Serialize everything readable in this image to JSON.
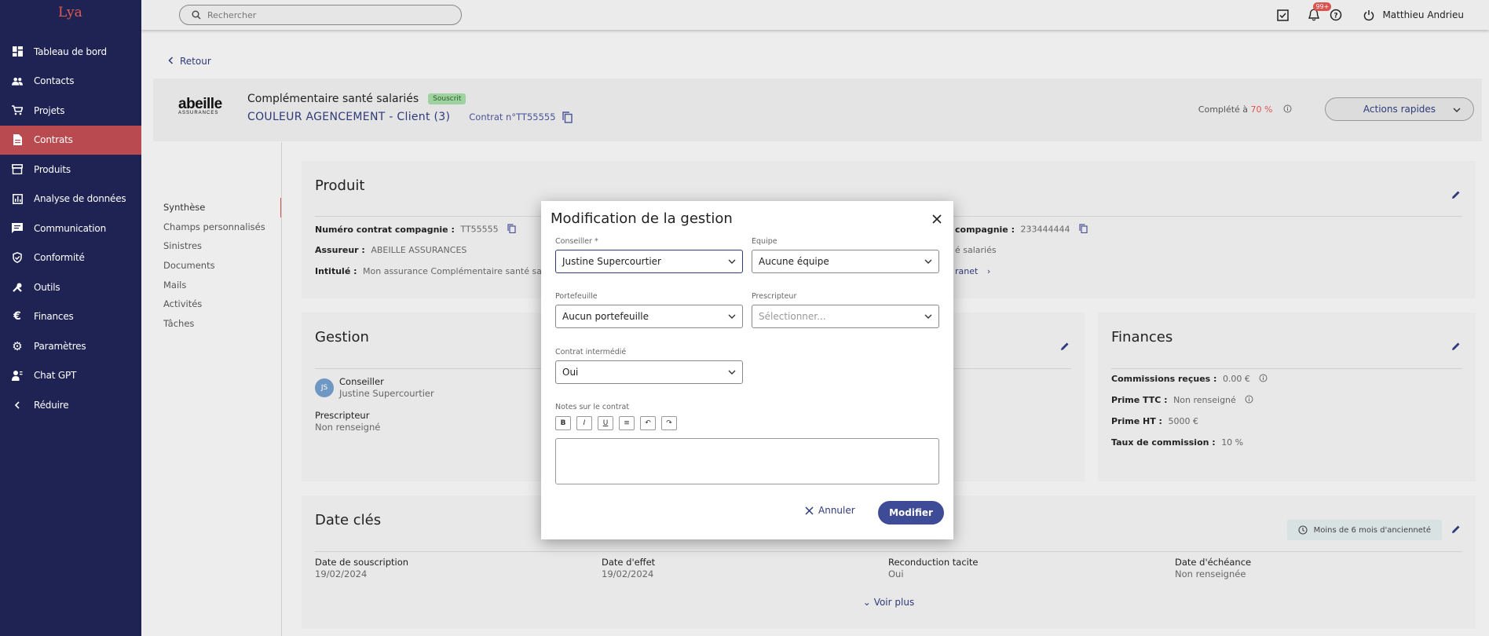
{
  "app": {
    "logo_text": "Lya"
  },
  "sidebar": {
    "items": [
      {
        "label": "Tableau de bord",
        "icon": "dashboard-icon"
      },
      {
        "label": "Contacts",
        "icon": "contacts-icon"
      },
      {
        "label": "Projets",
        "icon": "cart-icon"
      },
      {
        "label": "Contrats",
        "icon": "document-icon",
        "active": true
      },
      {
        "label": "Produits",
        "icon": "store-icon"
      },
      {
        "label": "Analyse de données",
        "icon": "chart-icon"
      },
      {
        "label": "Communication",
        "icon": "message-icon"
      },
      {
        "label": "Conformité",
        "icon": "shield-icon"
      },
      {
        "label": "Outils",
        "icon": "tools-icon"
      },
      {
        "label": "Finances",
        "icon": "euro-icon"
      },
      {
        "label": "Paramètres",
        "icon": "gear-icon"
      },
      {
        "label": "Chat GPT",
        "icon": "robot-icon"
      },
      {
        "label": "Réduire",
        "icon": "chevron-left-icon"
      }
    ]
  },
  "topbar": {
    "search_placeholder": "Rechercher",
    "notif_badge": "99+",
    "user_name": "Matthieu Andrieu"
  },
  "page": {
    "back_label": "Retour",
    "company_logo": "abeille",
    "company_logo_sub": "ASSURANCES",
    "contract_title": "Complémentaire santé salariés",
    "status": "Souscrit",
    "client_name": "COULEUR AGENCEMENT - Client (3)",
    "contract_number": "Contrat n°TT55555",
    "complete_prefix": "Complété à",
    "complete_pct": "70 %",
    "actions_label": "Actions rapides"
  },
  "tabs": [
    "Synthèse",
    "Champs personnalisés",
    "Sinistres",
    "Documents",
    "Mails",
    "Activités",
    "Tâches"
  ],
  "produit": {
    "title": "Produit",
    "numero_label": "Numéro contrat compagnie :",
    "numero_value": "TT55555",
    "assureur_label": "Assureur :",
    "assureur_value": "ABEILLE ASSURANCES",
    "intitule_label": "Intitulé :",
    "intitule_value": "Mon assurance Complémentaire santé sal",
    "right_label": "compagnie :",
    "right_value": "233444444",
    "right_line2": "é salariés",
    "right_link": "ranet"
  },
  "gestion": {
    "title": "Gestion",
    "avatar": "JS",
    "conseiller_label": "Conseiller",
    "conseiller_value": "Justine Supercourtier",
    "prescripteur_label": "Prescripteur",
    "prescripteur_value": "Non renseigné"
  },
  "finances": {
    "title": "Finances",
    "rows": [
      {
        "label": "Commissions reçues :",
        "value": "0.00 €"
      },
      {
        "label": "Prime TTC :",
        "value": "Non renseigné"
      },
      {
        "label": "Prime HT :",
        "value": "5000 €"
      },
      {
        "label": "Taux de commission :",
        "value": "10 %"
      }
    ]
  },
  "dates": {
    "title": "Date clés",
    "badge": "Moins de 6 mois d'ancienneté",
    "cols": [
      {
        "label": "Date de souscription",
        "value": "19/02/2024"
      },
      {
        "label": "Date d'effet",
        "value": "19/02/2024"
      },
      {
        "label": "Reconduction tacite",
        "value": "Oui"
      },
      {
        "label": "Date d'échéance",
        "value": "Non renseignée"
      }
    ],
    "voir_plus": "Voir plus"
  },
  "modal": {
    "title": "Modification de la gestion",
    "conseiller_label": "Conseiller *",
    "conseiller_value": "Justine Supercourtier",
    "equipe_label": "Equipe",
    "equipe_value": "Aucune équipe",
    "portefeuille_label": "Portefeuille",
    "portefeuille_value": "Aucun portefeuille",
    "prescripteur_label": "Prescripteur",
    "prescripteur_placeholder": "Sélectionner...",
    "intermedie_label": "Contrat intermédié",
    "intermedie_value": "Oui",
    "notes_label": "Notes sur le contrat",
    "toolbar": [
      "B",
      "I",
      "U",
      "≡",
      "↶",
      "↷"
    ],
    "cancel_label": "Annuler",
    "submit_label": "Modifier"
  }
}
